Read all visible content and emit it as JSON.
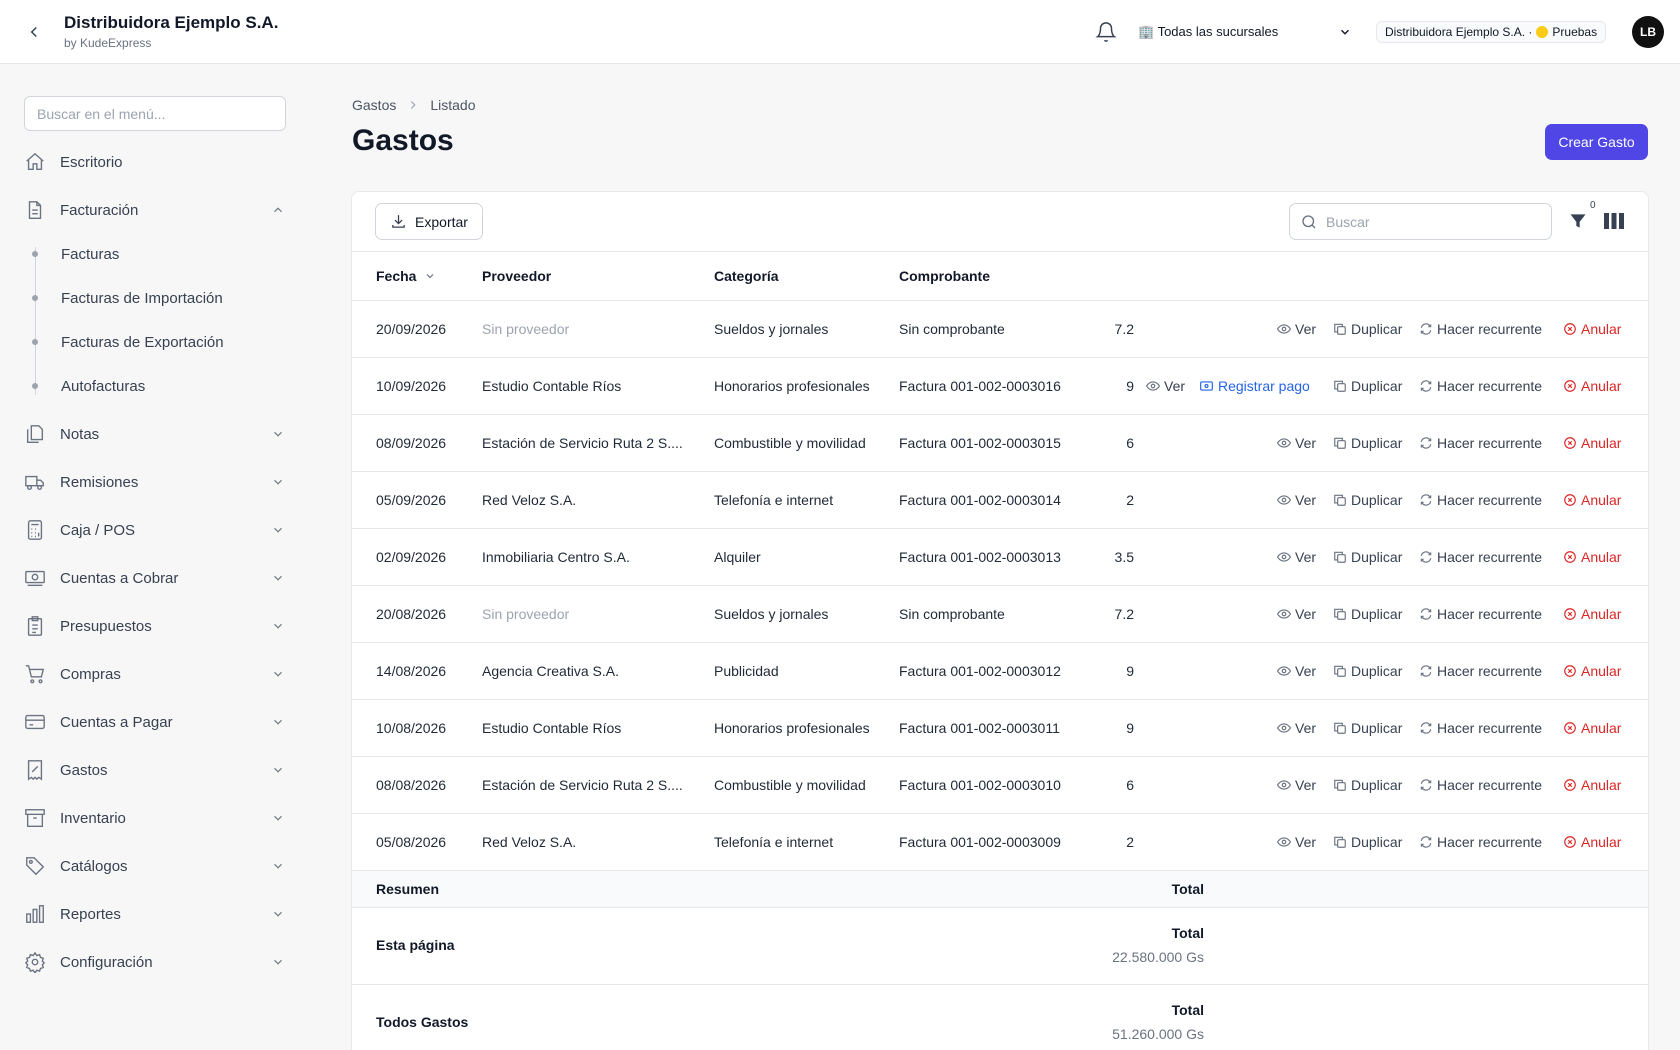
{
  "header": {
    "company": "Distribuidora Ejemplo S.A.",
    "byline": "by KudeExpress",
    "branch_select": "🏢 Todas las sucursales",
    "company_badge_name": "Distribuidora Ejemplo S.A. ·",
    "environment": "Pruebas",
    "avatar_initials": "LB"
  },
  "sidebar": {
    "search_placeholder": "Buscar en el menú...",
    "items": [
      {
        "label": "Escritorio",
        "icon": "home-icon"
      },
      {
        "label": "Facturación",
        "icon": "document-icon",
        "expanded": true
      },
      {
        "label": "Notas",
        "icon": "copy-icon"
      },
      {
        "label": "Remisiones",
        "icon": "truck-icon"
      },
      {
        "label": "Caja / POS",
        "icon": "calculator-icon"
      },
      {
        "label": "Cuentas a Cobrar",
        "icon": "cash-icon"
      },
      {
        "label": "Presupuestos",
        "icon": "clipboard-icon"
      },
      {
        "label": "Compras",
        "icon": "cart-icon"
      },
      {
        "label": "Cuentas a Pagar",
        "icon": "credit-card-icon"
      },
      {
        "label": "Gastos",
        "icon": "receipt-percent-icon"
      },
      {
        "label": "Inventario",
        "icon": "archive-box-icon"
      },
      {
        "label": "Catálogos",
        "icon": "tag-icon"
      },
      {
        "label": "Reportes",
        "icon": "chart-bar-icon"
      },
      {
        "label": "Configuración",
        "icon": "gear-icon"
      }
    ],
    "facturacion_sub": [
      "Facturas",
      "Facturas de Importación",
      "Facturas de Exportación",
      "Autofacturas"
    ]
  },
  "breadcrumb": {
    "parent": "Gastos",
    "current": "Listado"
  },
  "page_title": "Gastos",
  "create_button": "Crear Gasto",
  "toolbar": {
    "export_label": "Exportar",
    "search_placeholder": "Buscar",
    "filter_count": "0"
  },
  "table": {
    "columns": [
      "Fecha",
      "Proveedor",
      "Categoría",
      "Comprobante"
    ],
    "actions": {
      "view": "Ver",
      "pay": "Registrar pago",
      "duplicate": "Duplicar",
      "recurring": "Hacer recurrente",
      "void": "Anular"
    },
    "rows": [
      {
        "fecha": "20/09/2026",
        "proveedor": "Sin proveedor",
        "categoria": "Sueldos y jornales",
        "comprobante": "Sin comprobante",
        "monto": "7.2",
        "pay": false
      },
      {
        "fecha": "10/09/2026",
        "proveedor": "Estudio Contable Ríos",
        "categoria": "Honorarios profesionales",
        "comprobante": "Factura 001-002-0003016",
        "monto": "9",
        "pay": true
      },
      {
        "fecha": "08/09/2026",
        "proveedor": "Estación de Servicio Ruta 2 S....",
        "categoria": "Combustible y movilidad",
        "comprobante": "Factura 001-002-0003015",
        "monto": "6",
        "pay": false
      },
      {
        "fecha": "05/09/2026",
        "proveedor": "Red Veloz S.A.",
        "categoria": "Telefonía e internet",
        "comprobante": "Factura 001-002-0003014",
        "monto": "2",
        "pay": false
      },
      {
        "fecha": "02/09/2026",
        "proveedor": "Inmobiliaria Centro S.A.",
        "categoria": "Alquiler",
        "comprobante": "Factura 001-002-0003013",
        "monto": "3.5",
        "pay": false
      },
      {
        "fecha": "20/08/2026",
        "proveedor": "Sin proveedor",
        "categoria": "Sueldos y jornales",
        "comprobante": "Sin comprobante",
        "monto": "7.2",
        "pay": false
      },
      {
        "fecha": "14/08/2026",
        "proveedor": "Agencia Creativa S.A.",
        "categoria": "Publicidad",
        "comprobante": "Factura 001-002-0003012",
        "monto": "9",
        "pay": false
      },
      {
        "fecha": "10/08/2026",
        "proveedor": "Estudio Contable Ríos",
        "categoria": "Honorarios profesionales",
        "comprobante": "Factura 001-002-0003011",
        "monto": "9",
        "pay": false
      },
      {
        "fecha": "08/08/2026",
        "proveedor": "Estación de Servicio Ruta 2 S....",
        "categoria": "Combustible y movilidad",
        "comprobante": "Factura 001-002-0003010",
        "monto": "6",
        "pay": false
      },
      {
        "fecha": "05/08/2026",
        "proveedor": "Red Veloz S.A.",
        "categoria": "Telefonía e internet",
        "comprobante": "Factura 001-002-0003009",
        "monto": "2",
        "pay": false
      }
    ]
  },
  "summary": {
    "header_label": "Resumen",
    "header_total": "Total",
    "page_label": "Esta página",
    "page_total_label": "Total",
    "page_total_value": "22.580.000 Gs",
    "all_label": "Todos Gastos",
    "all_total_label": "Total",
    "all_total_value": "51.260.000 Gs"
  },
  "colors": {
    "accent": "#4f46e5",
    "danger": "#dc2626",
    "link": "#2563eb"
  }
}
